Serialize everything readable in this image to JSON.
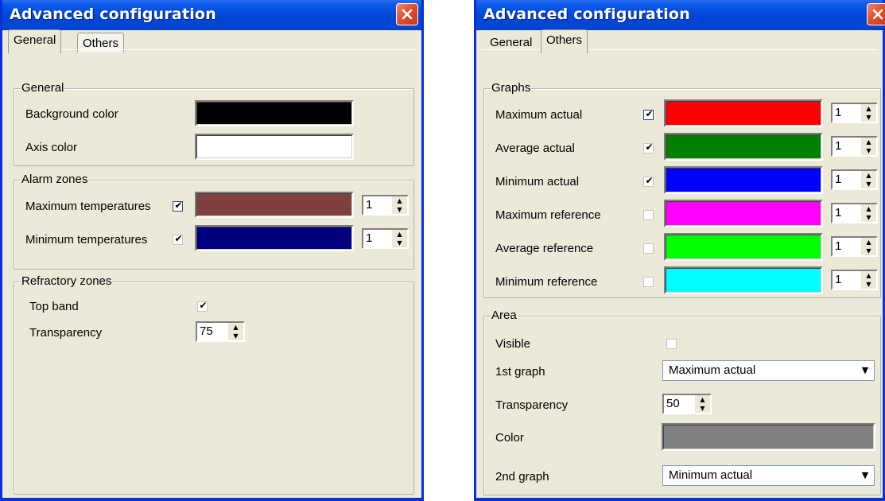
{
  "window_title": "Advanced configuration",
  "tabs": [
    "General",
    "Others"
  ],
  "general_tab": {
    "general_group": {
      "title": "General",
      "background_color_label": "Background color",
      "background_color": "#000000",
      "axis_color_label": "Axis color",
      "axis_color": "#ffffff"
    },
    "alarm_group": {
      "title": "Alarm zones",
      "rows": [
        {
          "label": "Maximum temperatures",
          "checked": true,
          "color": "#804040",
          "width": "1"
        },
        {
          "label": "Minimum temperatures",
          "checked": true,
          "color": "#000080",
          "width": "1"
        }
      ]
    },
    "refractory_group": {
      "title": "Refractory zones",
      "top_band_label": "Top band",
      "top_band_checked": true,
      "transparency_label": "Transparency",
      "transparency_value": "75"
    }
  },
  "others_tab": {
    "graphs_group": {
      "title": "Graphs",
      "rows": [
        {
          "label": "Maximum actual",
          "checked": true,
          "color": "#ff0000",
          "width": "1"
        },
        {
          "label": "Average actual",
          "checked": true,
          "color": "#008000",
          "width": "1"
        },
        {
          "label": "Minimum actual",
          "checked": true,
          "color": "#0000ff",
          "width": "1"
        },
        {
          "label": "Maximum reference",
          "checked": false,
          "color": "#ff00ff",
          "width": "1"
        },
        {
          "label": "Average reference",
          "checked": false,
          "color": "#00ff00",
          "width": "1"
        },
        {
          "label": "Minimum reference",
          "checked": false,
          "color": "#00ffff",
          "width": "1"
        }
      ]
    },
    "area_group": {
      "title": "Area",
      "visible_label": "Visible",
      "visible_checked": false,
      "first_graph_label": "1st graph",
      "first_graph_value": "Maximum actual",
      "transparency_label": "Transparency",
      "transparency_value": "50",
      "color_label": "Color",
      "color": "#808080",
      "second_graph_label": "2nd graph",
      "second_graph_value": "Minimum actual"
    }
  }
}
